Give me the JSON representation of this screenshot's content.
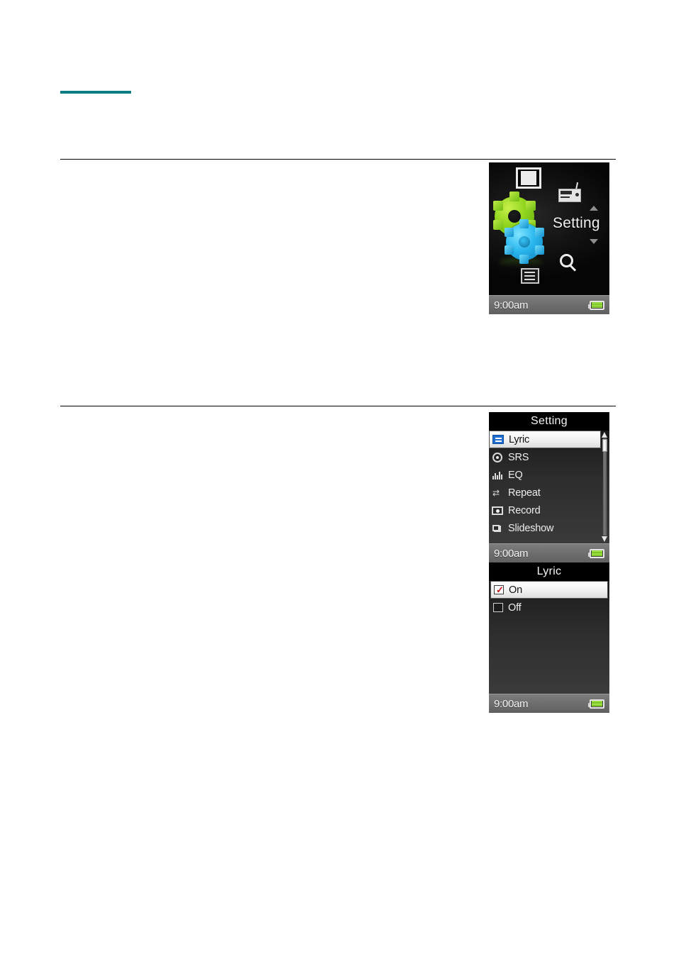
{
  "document": {
    "accent_color": "#0b7c84",
    "rule_color": "#000000"
  },
  "screens": {
    "home": {
      "label": "Setting",
      "icons": [
        {
          "name": "video-icon",
          "glyph": "film-strip"
        },
        {
          "name": "radio-icon",
          "glyph": "radio"
        },
        {
          "name": "search-icon",
          "glyph": "magnifier"
        },
        {
          "name": "list-icon",
          "glyph": "list"
        },
        {
          "name": "setting-gears-icon",
          "glyph": "gears",
          "colors": [
            "#8fd41d",
            "#2bb8ef"
          ]
        }
      ],
      "nav": {
        "up": "scroll-up-arrow",
        "down": "scroll-down-arrow"
      },
      "status": {
        "time": "9:00am",
        "battery": "battery-full-icon",
        "battery_color": "#7ed321"
      }
    },
    "setting_menu": {
      "title": "Setting",
      "items": [
        {
          "label": "Lyric",
          "icon": "lyric-icon",
          "selected": true
        },
        {
          "label": "SRS",
          "icon": "srs-icon",
          "selected": false
        },
        {
          "label": "EQ",
          "icon": "eq-icon",
          "selected": false
        },
        {
          "label": "Repeat",
          "icon": "repeat-icon",
          "selected": false
        },
        {
          "label": "Record",
          "icon": "record-icon",
          "selected": false
        },
        {
          "label": "Slideshow",
          "icon": "slideshow-icon",
          "selected": false
        }
      ],
      "scrollbar": {
        "position": "top"
      },
      "status": {
        "time": "9:00am",
        "battery": "battery-full-icon"
      }
    },
    "lyric_menu": {
      "title": "Lyric",
      "options": [
        {
          "label": "On",
          "checked": true,
          "selected": true,
          "check_color": "#c1121f"
        },
        {
          "label": "Off",
          "checked": false,
          "selected": false
        }
      ],
      "status": {
        "time": "9:00am",
        "battery": "battery-full-icon"
      }
    }
  }
}
